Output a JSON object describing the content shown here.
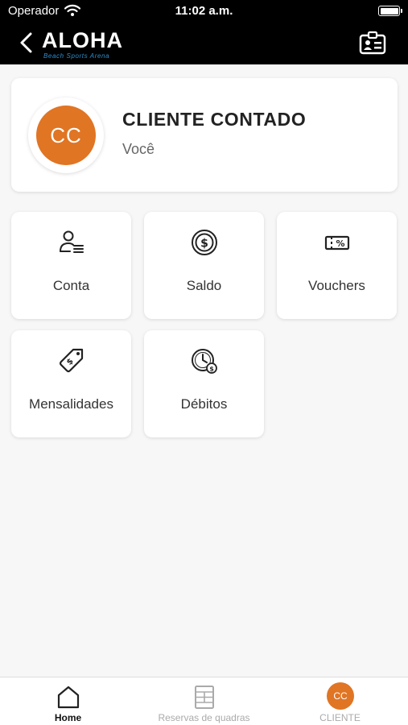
{
  "status_bar": {
    "carrier": "Operador",
    "time": "11:02 a.m."
  },
  "header": {
    "logo_text": "ALOHA",
    "logo_subtitle": "Beach Sports Arena"
  },
  "profile": {
    "initials": "CC",
    "name": "CLIENTE CONTADO",
    "role": "Você"
  },
  "menu": {
    "conta": "Conta",
    "saldo": "Saldo",
    "vouchers": "Vouchers",
    "mensalidades": "Mensalidades",
    "debitos": "Débitos"
  },
  "tabbar": {
    "home": "Home",
    "reservas": "Reservas de quadras",
    "cliente": "CLIENTE",
    "cliente_initials": "CC"
  },
  "colors": {
    "accent": "#e07524",
    "header_bg": "#000000",
    "logo_sub": "#2d8fd0"
  }
}
